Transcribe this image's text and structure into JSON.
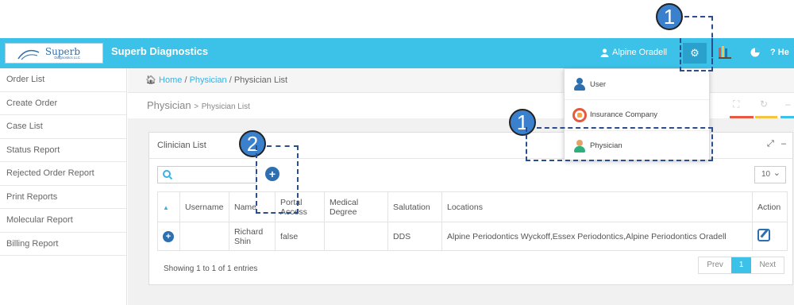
{
  "app": {
    "logo_text": "Superb",
    "logo_sub": "Diagnostics LLC",
    "brand": "Superb Diagnostics",
    "user_name": "Alpine Oradell",
    "help_label": "? He"
  },
  "sidebar": {
    "items": [
      {
        "label": "Order List"
      },
      {
        "label": "Create Order"
      },
      {
        "label": "Case List"
      },
      {
        "label": "Status Report"
      },
      {
        "label": "Rejected Order Report"
      },
      {
        "label": "Print Reports"
      },
      {
        "label": "Molecular Report"
      },
      {
        "label": "Billing Report"
      }
    ]
  },
  "breadcrumb": {
    "home": "Home",
    "sep1": "/",
    "physician": "Physician",
    "sep2": "/",
    "current": "Physician List"
  },
  "page": {
    "title": "Physician",
    "arrow": ">",
    "subtitle": "Physician List"
  },
  "panel": {
    "title": "Clinician List",
    "page_length": "10",
    "info": "Showing 1 to 1 of 1 entries",
    "prev": "Prev",
    "page_num": "1",
    "next": "Next"
  },
  "table": {
    "headers": [
      "Username",
      "Name",
      "Portal Access",
      "Medical Degree",
      "Salutation",
      "Locations",
      "Action"
    ],
    "rows": [
      {
        "username": "",
        "name": "Richard Shin",
        "portal_access": "false",
        "medical_degree": "",
        "salutation": "DDS",
        "locations": "Alpine Periodontics Wyckoff,Essex Periodontics,Alpine Periodontics Oradell"
      }
    ]
  },
  "dropdown": {
    "items": [
      {
        "label": "User"
      },
      {
        "label": "Insurance Company"
      },
      {
        "label": "Physician"
      }
    ]
  },
  "annotations": {
    "callout_1a": "1",
    "callout_1b": "1",
    "callout_2": "2"
  },
  "colors": {
    "header": "#3cc1e8",
    "primary": "#2e6fb0",
    "callout": "#3a80cc"
  }
}
